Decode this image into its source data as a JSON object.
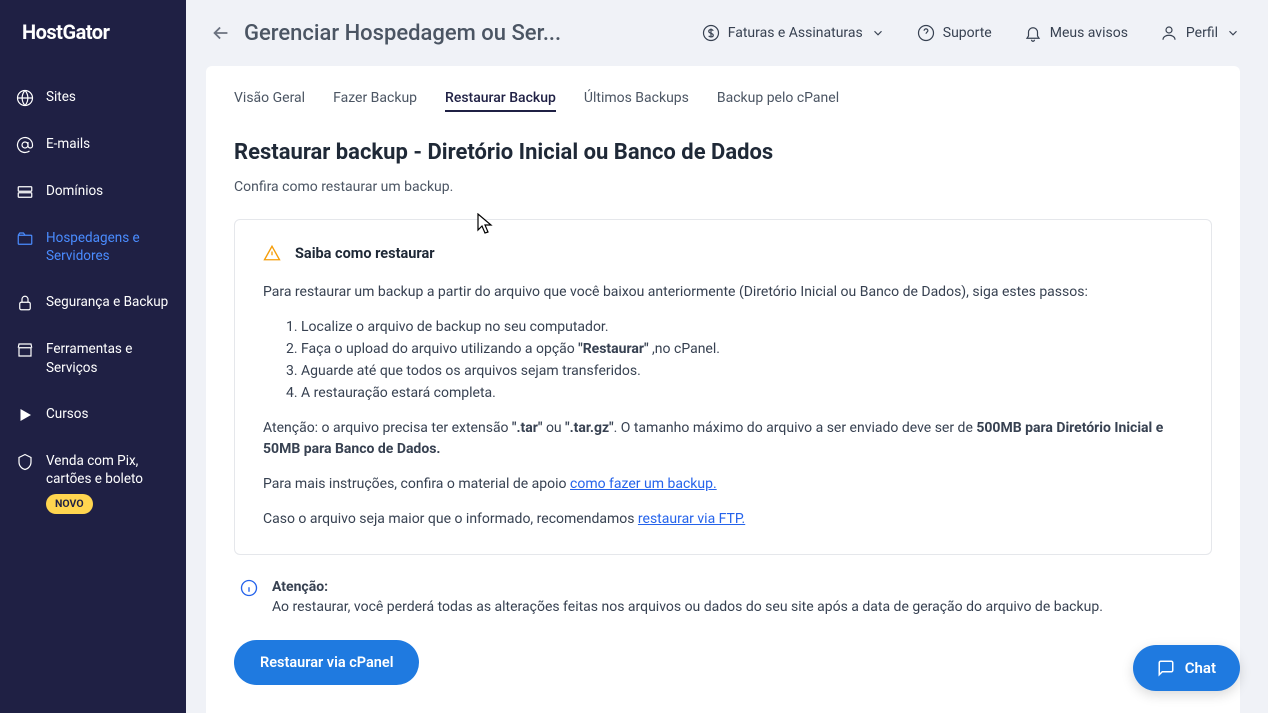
{
  "brand": "HostGator",
  "sidebar": {
    "items": [
      {
        "label": "Sites",
        "icon": "globe"
      },
      {
        "label": "E-mails",
        "icon": "at"
      },
      {
        "label": "Domínios",
        "icon": "server"
      },
      {
        "label": "Hospedagens e Servidores",
        "icon": "folder",
        "active": true
      },
      {
        "label": "Segurança e Backup",
        "icon": "lock"
      },
      {
        "label": "Ferramentas e Serviços",
        "icon": "store"
      },
      {
        "label": "Cursos",
        "icon": "play"
      },
      {
        "label": "Venda com Pix, cartões e boleto",
        "icon": "shield",
        "badge": "NOVO"
      }
    ]
  },
  "header": {
    "title": "Gerenciar Hospedagem ou Ser...",
    "actions": {
      "invoices": "Faturas e Assinaturas",
      "support": "Suporte",
      "notices": "Meus avisos",
      "profile": "Perfil"
    }
  },
  "tabs": [
    {
      "label": "Visão Geral"
    },
    {
      "label": "Fazer Backup"
    },
    {
      "label": "Restaurar Backup",
      "active": true
    },
    {
      "label": "Últimos Backups"
    },
    {
      "label": "Backup pelo cPanel"
    }
  ],
  "section": {
    "title": "Restaurar backup - Diretório Inicial ou Banco de Dados",
    "subtitle": "Confira como restaurar um backup."
  },
  "infobox": {
    "title": "Saiba como restaurar",
    "intro": "Para restaurar um backup a partir do arquivo que você baixou anteriormente (Diretório Inicial ou Banco de Dados), siga estes passos:",
    "steps": [
      "Localize o arquivo de backup no seu computador.",
      "Faça o upload do arquivo utilizando a opção ",
      "Aguarde até que todos os arquivos sejam transferidos.",
      "A restauração estará completa."
    ],
    "step2_strong": "\"Restaurar\"",
    "step2_suffix": " ,no cPanel.",
    "attention_prefix": "Atenção: o arquivo precisa ter extensão ",
    "ext1": "\".tar\"",
    "ext_or": " ou ",
    "ext2": "\".tar.gz\"",
    "attention_mid": ". O tamanho máximo do arquivo a ser enviado deve ser de ",
    "size_limit": "500MB para Diretório Inicial e 50MB para Banco de Dados.",
    "more_instructions": "Para mais instruções, confira o material de apoio ",
    "link1": "como fazer um backup.",
    "larger_file": "Caso o arquivo seja maior que o informado, recomendamos ",
    "link2": "restaurar via FTP."
  },
  "attention": {
    "title": "Atenção:",
    "body": "Ao restaurar, você perderá todas as alterações feitas nos arquivos ou dados do seu site após a data de geração do arquivo de backup."
  },
  "button": "Restaurar via cPanel",
  "chat": "Chat"
}
